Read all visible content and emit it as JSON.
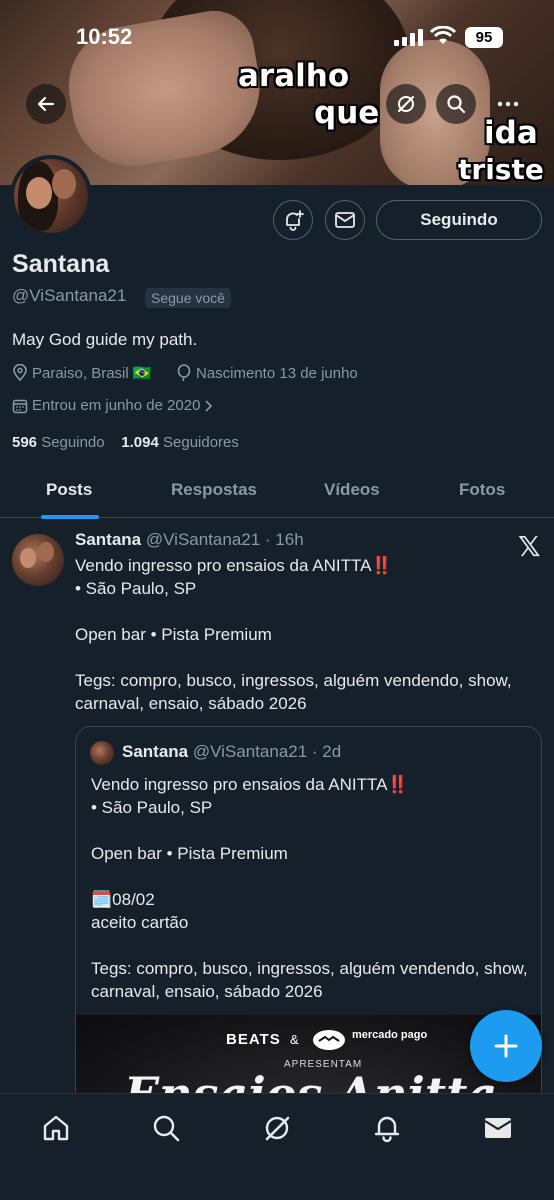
{
  "status_bar": {
    "time": "10:52",
    "battery": "95"
  },
  "banner": {
    "meme_line1": "aralho",
    "meme_line2": "que",
    "meme_line3": "ida",
    "meme_line4": "triste"
  },
  "profile": {
    "name": "Santana",
    "handle": "@ViSantana21",
    "follows_you": "Segue você",
    "bio": "May God guide my path.",
    "location": "Paraiso, Brasil 🇧🇷",
    "birthday": "Nascimento 13 de junho",
    "joined": "Entrou em junho de 2020",
    "following_count": "596",
    "following_label": "Seguindo",
    "followers_count": "1.094",
    "followers_label": "Seguidores",
    "follow_button": "Seguindo"
  },
  "tabs": [
    {
      "label": "Posts",
      "active": true
    },
    {
      "label": "Respostas",
      "active": false
    },
    {
      "label": "Vídeos",
      "active": false
    },
    {
      "label": "Fotos",
      "active": false
    }
  ],
  "post": {
    "name": "Santana",
    "meta": "@ViSantana21 · 16h",
    "text": "Vendo ingresso pro ensaios da ANITTA‼️\n• São Paulo, SP\n\nOpen bar • Pista Premium\n\nTegs: compro, busco, ingressos, alguém vendendo, show, carnaval, ensaio, sábado 2026"
  },
  "quote": {
    "name": "Santana",
    "meta": "@ViSantana21 · 2d",
    "text": "Vendo ingresso pro ensaios da ANITTA‼️\n• São Paulo, SP\n\nOpen bar • Pista Premium\n\n🗓️08/02\naceito cartão\n\nTegs: compro, busco, ingressos, alguém vendendo, show, carnaval, ensaio, sábado 2026",
    "image_brand": "BEATS",
    "image_amp": "&",
    "image_brand2": "mercado pago",
    "image_presents": "APRESENTAM"
  },
  "colors": {
    "accent": "#1d9bf0",
    "background": "#15202b",
    "secondary_text": "#8b98a5"
  }
}
